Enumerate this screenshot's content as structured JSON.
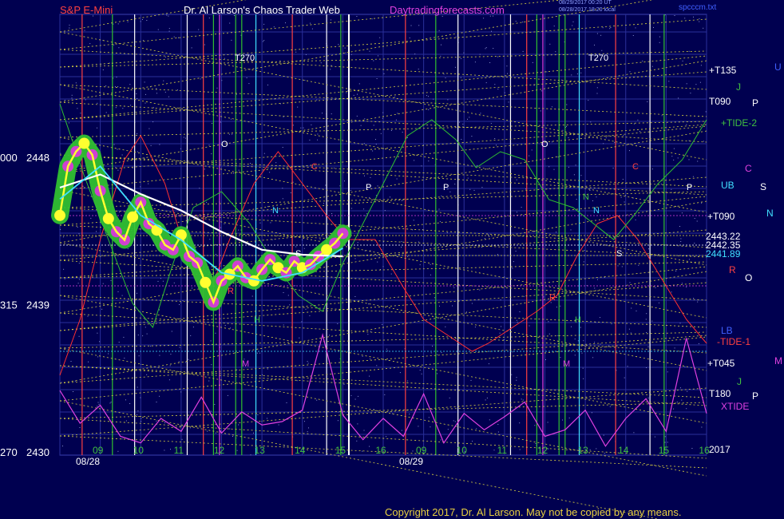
{
  "header": {
    "symbol": "S&P E-Mini",
    "site": "Dr. Al Larson's Chaos Trader Web",
    "url": "Daytradingforecasts.com",
    "stamp1": "08/29/2017 00:20 UT",
    "stamp2": "08/28/2017 18:20 local",
    "file": "spcccm.txt"
  },
  "footer": {
    "copyright": "Copyright 2017, Dr. Al Larson. May not be copied by any means."
  },
  "colors": {
    "background": "#000050",
    "grid": "#2a2f9a",
    "price": "#ffffff",
    "flux": "#ff3030",
    "tide": "#30c030",
    "xtide": "#e040e0"
  },
  "chart_data": {
    "type": "line",
    "ylim": [
      2430,
      2452
    ],
    "y_ticks": [
      {
        "left": "000",
        "value": 2448,
        "label": "2448"
      },
      {
        "left": "315",
        "value": 2439,
        "label": "2439"
      },
      {
        "left": "270",
        "value": 2430,
        "label": "2430"
      }
    ],
    "x_hour_labels": [
      "09",
      "10",
      "11",
      "12",
      "13",
      "14",
      "15",
      "16",
      "09",
      "10",
      "11",
      "12",
      "13",
      "14",
      "15",
      "16"
    ],
    "x_date_labels": [
      "08/28",
      "08/29"
    ],
    "price_readouts": [
      "2443.22",
      "2442.35",
      "2441.89"
    ],
    "right_labels": [
      "+T135",
      "T090",
      "+TIDE-2",
      "UB",
      "+T090",
      "LB",
      "-TIDE-1",
      "+T045",
      "T180",
      "XTIDE",
      "2017"
    ],
    "planet_letters": [
      "U",
      "J",
      "P",
      "C",
      "S",
      "N",
      "R",
      "O",
      "P",
      "M",
      "J"
    ],
    "chart_letters": [
      "T270",
      "T270",
      "O",
      "O",
      "C",
      "C",
      "P",
      "P",
      "P",
      "N",
      "N",
      "N",
      "S",
      "S",
      "H",
      "H",
      "M",
      "M",
      "R",
      "R"
    ],
    "series": [
      {
        "name": "S&P E-Mini",
        "x": [
          0,
          0.2,
          0.4,
          0.6,
          0.8,
          1.0,
          1.2,
          1.4,
          1.6,
          1.8,
          2.0,
          2.2,
          2.4,
          2.6,
          2.8,
          3.0,
          3.2,
          3.4,
          3.6,
          3.8,
          4.0,
          4.2,
          4.4,
          4.6,
          4.8,
          5.0,
          5.2,
          5.4,
          5.6,
          5.8,
          6.0,
          6.2,
          6.4,
          6.6,
          6.8,
          7.0
        ],
        "y": [
          2444.5,
          2447.5,
          2448.4,
          2448.9,
          2448.2,
          2446.0,
          2444.3,
          2443.5,
          2443.0,
          2444.4,
          2445.3,
          2444.0,
          2443.6,
          2442.7,
          2442.4,
          2443.3,
          2442.0,
          2441.6,
          2440.4,
          2439.2,
          2440.5,
          2440.9,
          2441.4,
          2440.7,
          2440.5,
          2441.2,
          2441.8,
          2441.3,
          2441.0,
          2441.7,
          2441.3,
          2441.5,
          2442.0,
          2442.4,
          2442.8,
          2443.4
        ]
      },
      {
        "name": "xtide",
        "x": [
          0,
          0.5,
          1.0,
          1.5,
          2.0,
          2.5,
          3.0,
          3.5,
          4.0,
          4.5,
          5.0,
          5.5,
          6.0,
          6.5,
          7.0,
          7.5,
          8.0,
          8.5,
          9.0,
          9.5,
          10.0,
          10.5,
          11.0,
          11.5,
          12.0,
          12.5,
          13.0,
          13.5,
          14.0,
          14.5,
          15.0,
          15.5,
          16.0
        ],
        "y": [
          2433.8,
          2431.8,
          2432.9,
          2431.0,
          2430.6,
          2432.1,
          2431.3,
          2433.4,
          2431.2,
          2432.5,
          2431.7,
          2431.9,
          2432.6,
          2437.2,
          2432.3,
          2430.8,
          2432.1,
          2431.0,
          2433.6,
          2430.6,
          2432.4,
          2431.4,
          2432.2,
          2433.1,
          2431.0,
          2431.4,
          2432.6,
          2430.4,
          2432.1,
          2433.3,
          2431.3,
          2437.0,
          2432.4
        ]
      }
    ]
  }
}
